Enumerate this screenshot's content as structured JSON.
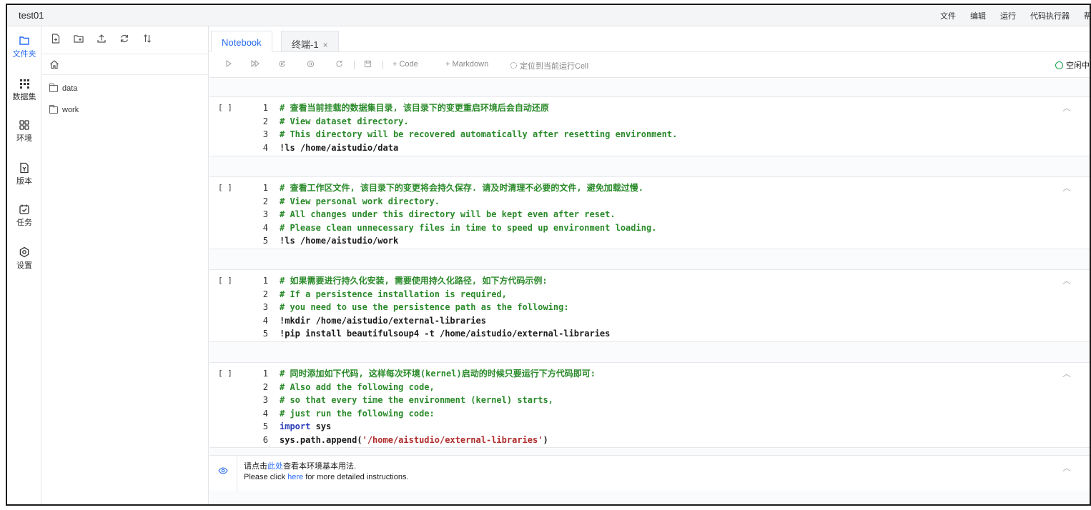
{
  "app": {
    "project_name": "test01",
    "menu": [
      "文件",
      "编辑",
      "运行",
      "代码执行器",
      "帮助"
    ]
  },
  "activity_bar": [
    {
      "label": "文件夹",
      "icon": "folder-icon",
      "active": true
    },
    {
      "label": "数据集",
      "icon": "dataset-icon",
      "active": false
    },
    {
      "label": "环境",
      "icon": "environment-icon",
      "active": false
    },
    {
      "label": "版本",
      "icon": "version-icon",
      "active": false
    },
    {
      "label": "任务",
      "icon": "task-icon",
      "active": false
    },
    {
      "label": "设置",
      "icon": "settings-icon",
      "active": false
    }
  ],
  "file_panel": {
    "toolbar_icons": [
      "new-file-icon",
      "new-folder-icon",
      "upload-icon",
      "refresh-icon",
      "sort-icon"
    ],
    "home_icon": "home-icon",
    "items": [
      {
        "name": "data",
        "type": "folder"
      },
      {
        "name": "work",
        "type": "folder"
      }
    ]
  },
  "tabs": [
    {
      "label": "Notebook",
      "active": true
    },
    {
      "label": "终端-1",
      "active": false,
      "close": "×"
    }
  ],
  "toolbar": {
    "add_code": "+ Code",
    "add_markdown": "+ Markdown",
    "locate_cell": "定位到当前运行Cell",
    "kernel_status": "空闲中"
  },
  "cells": [
    {
      "prompt": "[ ]",
      "lines": [
        [
          [
            "cm",
            "# 查看当前挂载的数据集目录, 该目录下的变更重启环境后会自动还原"
          ]
        ],
        [
          [
            "cm",
            "# View dataset directory."
          ]
        ],
        [
          [
            "cm",
            "# This directory will be recovered automatically after resetting environment."
          ]
        ],
        [
          [
            "tx",
            "!ls /home/aistudio/data"
          ]
        ]
      ]
    },
    {
      "prompt": "[ ]",
      "lines": [
        [
          [
            "cm",
            "# 查看工作区文件, 该目录下的变更将会持久保存. 请及时清理不必要的文件, 避免加载过慢."
          ]
        ],
        [
          [
            "cm",
            "# View personal work directory."
          ]
        ],
        [
          [
            "cm",
            "# All changes under this directory will be kept even after reset."
          ]
        ],
        [
          [
            "cm",
            "# Please clean unnecessary files in time to speed up environment loading."
          ]
        ],
        [
          [
            "tx",
            "!ls /home/aistudio/work"
          ]
        ]
      ]
    },
    {
      "prompt": "[ ]",
      "lines": [
        [
          [
            "cm",
            "# 如果需要进行持久化安装, 需要使用持久化路径, 如下方代码示例:"
          ]
        ],
        [
          [
            "cm",
            "# If a persistence installation is required,"
          ]
        ],
        [
          [
            "cm",
            "# you need to use the persistence path as the following:"
          ]
        ],
        [
          [
            "tx",
            "!mkdir /home/aistudio/external-libraries"
          ]
        ],
        [
          [
            "tx",
            "!pip install beautifulsoup4 -t /home/aistudio/external-libraries"
          ]
        ]
      ]
    },
    {
      "prompt": "[ ]",
      "lines": [
        [
          [
            "cm",
            "# 同时添加如下代码, 这样每次环境(kernel)启动的时候只要运行下方代码即可:"
          ]
        ],
        [
          [
            "cm",
            "# Also add the following code,"
          ]
        ],
        [
          [
            "cm",
            "# so that every time the environment (kernel) starts,"
          ]
        ],
        [
          [
            "cm",
            "# just run the following code:"
          ]
        ],
        [
          [
            "kw",
            "import"
          ],
          [
            "tx",
            " sys"
          ]
        ],
        [
          [
            "tx",
            "sys.path.append("
          ],
          [
            "st",
            "'/home/aistudio/external-libraries'"
          ],
          [
            "tx",
            ")"
          ]
        ]
      ]
    }
  ],
  "markdown_cell": {
    "zh_before": "请点击",
    "zh_link": "此处",
    "zh_after": "查看本环境基本用法.",
    "en_before": "Please click ",
    "en_link": "here",
    "en_after": " for more detailed instructions."
  }
}
